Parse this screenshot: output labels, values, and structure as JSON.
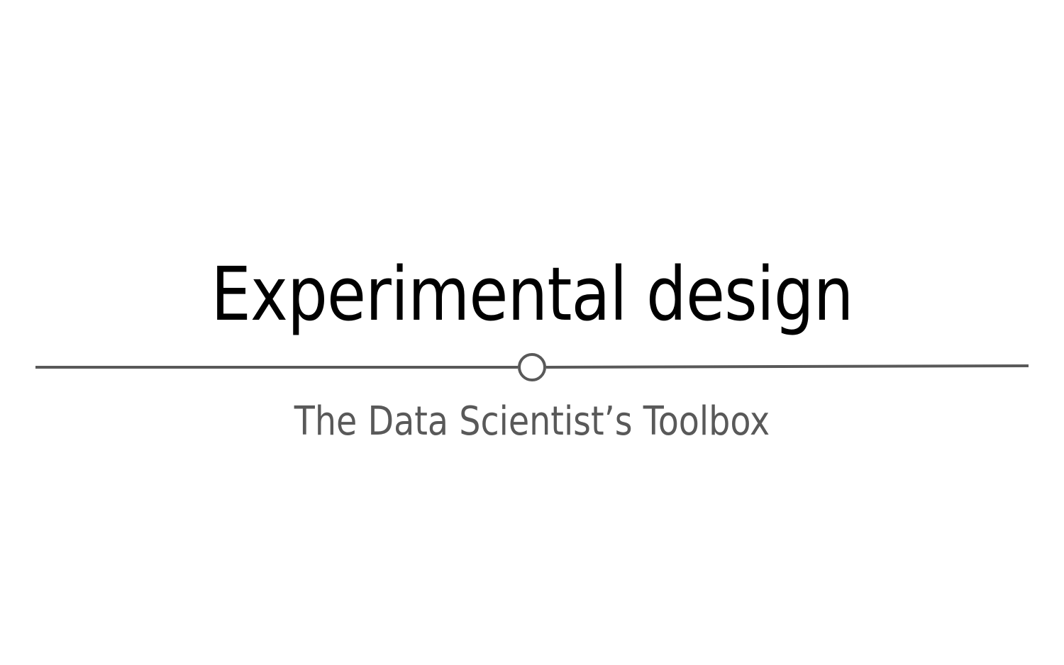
{
  "slide": {
    "title": "Experimental design",
    "subtitle": "The Data Scientist’s Toolbox",
    "colors": {
      "title": "#000000",
      "subtitle": "#595959",
      "divider": "#595959",
      "background": "#ffffff"
    }
  }
}
